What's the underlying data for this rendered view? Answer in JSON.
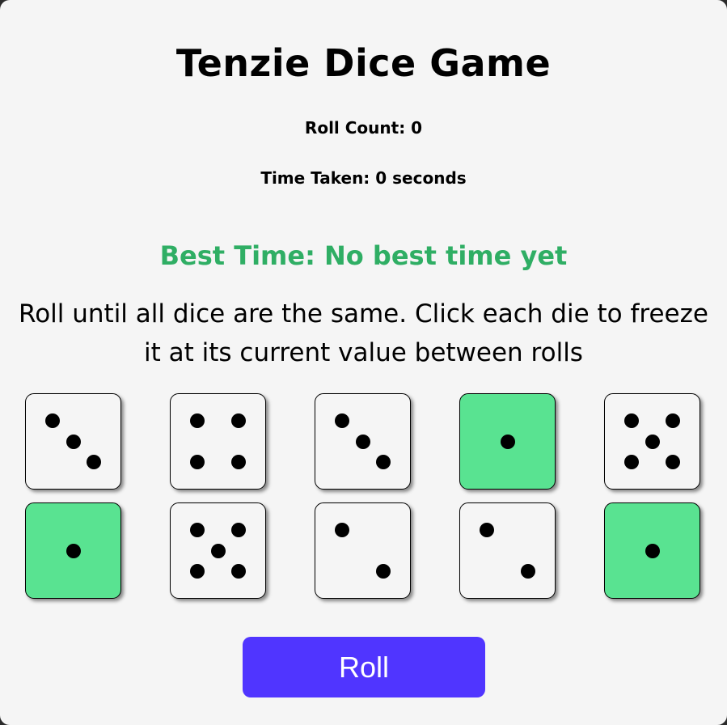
{
  "game": {
    "title": "Tenzie Dice Game",
    "roll_count_text": "Roll Count: 0",
    "roll_count": 0,
    "time_taken_text": "Time Taken: 0 seconds",
    "time_taken_seconds": 0,
    "best_time_text": "Best Time: No best time yet",
    "instructions": "Roll until all dice are the same. Click each die to freeze it at its current value between rolls",
    "roll_button_label": "Roll"
  },
  "dice": [
    {
      "value": 3,
      "held": false
    },
    {
      "value": 4,
      "held": false
    },
    {
      "value": 3,
      "held": false
    },
    {
      "value": 1,
      "held": true
    },
    {
      "value": 5,
      "held": false
    },
    {
      "value": 1,
      "held": true
    },
    {
      "value": 5,
      "held": false
    },
    {
      "value": 2,
      "held": false
    },
    {
      "value": 2,
      "held": false
    },
    {
      "value": 1,
      "held": true
    }
  ],
  "colors": {
    "held_die": "#59e391",
    "free_die": "#f5f5f5",
    "best_time": "#2fae64",
    "roll_button": "#5035ff",
    "background": "#f5f5f5"
  }
}
